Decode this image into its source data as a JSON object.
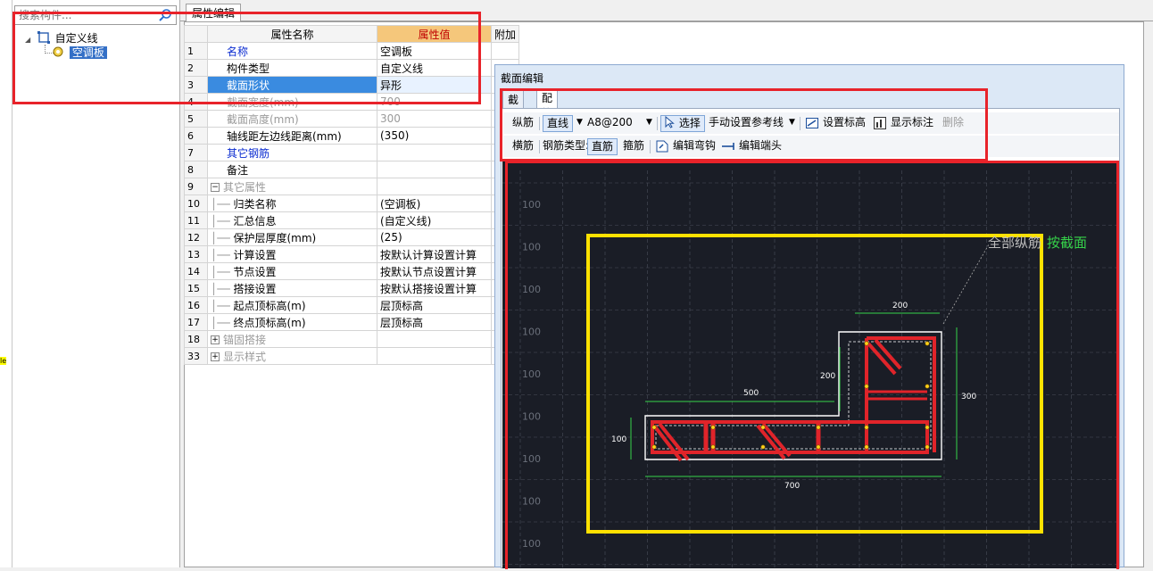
{
  "search": {
    "placeholder": "搜索构件..."
  },
  "tree": {
    "root_label": "自定义线",
    "child_label": "空调板"
  },
  "tabs": {
    "property_edit": "属性编辑"
  },
  "table": {
    "headers": {
      "name": "属性名称",
      "value": "属性值",
      "extra": "附加"
    },
    "rows": [
      {
        "num": "1",
        "name": "名称",
        "value": "空调板",
        "style": "blue"
      },
      {
        "num": "2",
        "name": "构件类型",
        "value": "自定义线",
        "style": ""
      },
      {
        "num": "3",
        "name": "截面形状",
        "value": "异形",
        "style": "sel"
      },
      {
        "num": "4",
        "name": "截面宽度(mm)",
        "value": "700",
        "style": "grey"
      },
      {
        "num": "5",
        "name": "截面高度(mm)",
        "value": "300",
        "style": "grey"
      },
      {
        "num": "6",
        "name": "轴线距左边线距离(mm)",
        "value": "(350)",
        "style": ""
      },
      {
        "num": "7",
        "name": "其它钢筋",
        "value": "",
        "style": "blue"
      },
      {
        "num": "8",
        "name": "备注",
        "value": "",
        "style": ""
      },
      {
        "num": "9",
        "name": "其它属性",
        "value": "",
        "style": "group-open"
      },
      {
        "num": "10",
        "name": "归类名称",
        "value": "(空调板)",
        "style": "child"
      },
      {
        "num": "11",
        "name": "汇总信息",
        "value": "(自定义线)",
        "style": "child"
      },
      {
        "num": "12",
        "name": "保护层厚度(mm)",
        "value": "(25)",
        "style": "child"
      },
      {
        "num": "13",
        "name": "计算设置",
        "value": "按默认计算设置计算",
        "style": "child"
      },
      {
        "num": "14",
        "name": "节点设置",
        "value": "按默认节点设置计算",
        "style": "child"
      },
      {
        "num": "15",
        "name": "搭接设置",
        "value": "按默认搭接设置计算",
        "style": "child"
      },
      {
        "num": "16",
        "name": "起点顶标高(m)",
        "value": "层顶标高",
        "style": "child"
      },
      {
        "num": "17",
        "name": "终点顶标高(m)",
        "value": "层顶标高",
        "style": "child"
      },
      {
        "num": "18",
        "name": "锚固搭接",
        "value": "",
        "style": "group-closed"
      },
      {
        "num": "33",
        "name": "显示样式",
        "value": "",
        "style": "group-closed"
      }
    ]
  },
  "dialog": {
    "title": "截面编辑",
    "tabs": [
      "截面",
      "配筋"
    ],
    "toolbar1": {
      "longitudinal": "纵筋",
      "line": "直线",
      "rebar_spec": "A8@200",
      "select": "选择",
      "manual_ref": "手动设置参考线",
      "set_elevation": "设置标高",
      "show_label": "显示标注",
      "delete": "删除"
    },
    "toolbar2": {
      "transverse": "横筋",
      "rebar_type": "钢筋类型:",
      "straight": "直筋",
      "stirrup": "箍筋",
      "edit_hook": "编辑弯钩",
      "edit_end": "编辑端头"
    }
  },
  "canvas": {
    "grid_label": "100",
    "annotation_prefix": "全部纵筋",
    "annotation_suffix": "按截面",
    "dims": {
      "top": "200",
      "left_vertical": "200",
      "middle": "500",
      "right_vertical": "300",
      "flange": "100",
      "bottom": "700"
    },
    "colors": {
      "bg": "#1a1d26",
      "grid": "#4a4f5a",
      "outline": "#ffffff",
      "rebar": "#e0242a",
      "dim": "#36d24a",
      "highlight": "#ffe100"
    }
  },
  "left_strip": {
    "mark": "le"
  }
}
